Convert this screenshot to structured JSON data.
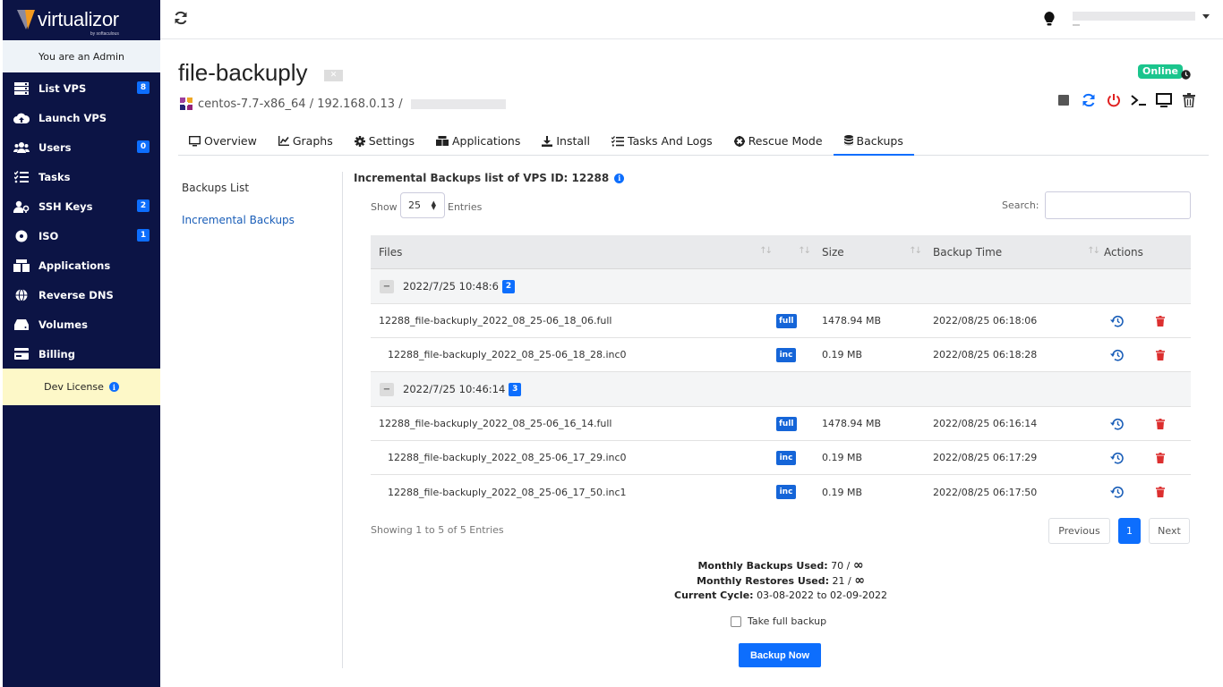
{
  "brand": {
    "name": "virtualizor",
    "sub": "by softaculous"
  },
  "sidebar": {
    "admin_text": "You are an Admin",
    "items": [
      {
        "label": "List VPS",
        "icon": "server-icon",
        "badge": "8"
      },
      {
        "label": "Launch VPS",
        "icon": "cloud-upload-icon",
        "badge": ""
      },
      {
        "label": "Users",
        "icon": "users-icon",
        "badge": "0"
      },
      {
        "label": "Tasks",
        "icon": "tasks-icon",
        "badge": ""
      },
      {
        "label": "SSH Keys",
        "icon": "user-key-icon",
        "badge": "2"
      },
      {
        "label": "ISO",
        "icon": "disc-icon",
        "badge": "1"
      },
      {
        "label": "Applications",
        "icon": "boxes-icon",
        "badge": ""
      },
      {
        "label": "Reverse DNS",
        "icon": "globe-icon",
        "badge": ""
      },
      {
        "label": "Volumes",
        "icon": "hdd-icon",
        "badge": ""
      },
      {
        "label": "Billing",
        "icon": "billing-icon",
        "badge": ""
      }
    ],
    "dev_license": "Dev License"
  },
  "vps": {
    "title": "file-backuply",
    "os": "centos-7.7-x86_64",
    "ip": "192.168.0.13",
    "separator": "/",
    "status": "Online"
  },
  "tabs": [
    {
      "label": "Overview",
      "icon": "monitor-icon"
    },
    {
      "label": "Graphs",
      "icon": "chart-icon"
    },
    {
      "label": "Settings",
      "icon": "gear-icon"
    },
    {
      "label": "Applications",
      "icon": "boxes-icon"
    },
    {
      "label": "Install",
      "icon": "download-icon"
    },
    {
      "label": "Tasks And Logs",
      "icon": "tasks-icon"
    },
    {
      "label": "Rescue Mode",
      "icon": "lifebuoy-icon"
    },
    {
      "label": "Backups",
      "icon": "database-icon"
    }
  ],
  "submenu": {
    "backups_list": "Backups List",
    "incremental": "Incremental Backups"
  },
  "main": {
    "title": "Incremental Backups list of VPS ID: 12288",
    "show_label": "Show",
    "show_value": "25",
    "entries_label": "Entries",
    "search_label": "Search:",
    "search_value": "",
    "headers": {
      "files": "Files",
      "size": "Size",
      "time": "Backup Time",
      "actions": "Actions"
    },
    "groups": [
      {
        "label": "2022/7/25 10:48:6",
        "count": "2",
        "rows": [
          {
            "file": "12288_file-backuply_2022_08_25-06_18_06.full",
            "type": "full",
            "size": "1478.94 MB",
            "time": "2022/08/25 06:18:06",
            "child": false
          },
          {
            "file": "12288_file-backuply_2022_08_25-06_18_28.inc0",
            "type": "inc",
            "size": "0.19 MB",
            "time": "2022/08/25 06:18:28",
            "child": true
          }
        ]
      },
      {
        "label": "2022/7/25 10:46:14",
        "count": "3",
        "rows": [
          {
            "file": "12288_file-backuply_2022_08_25-06_16_14.full",
            "type": "full",
            "size": "1478.94 MB",
            "time": "2022/08/25 06:16:14",
            "child": false
          },
          {
            "file": "12288_file-backuply_2022_08_25-06_17_29.inc0",
            "type": "inc",
            "size": "0.19 MB",
            "time": "2022/08/25 06:17:29",
            "child": true
          },
          {
            "file": "12288_file-backuply_2022_08_25-06_17_50.inc1",
            "type": "inc",
            "size": "0.19 MB",
            "time": "2022/08/25 06:17:50",
            "child": true
          }
        ]
      }
    ],
    "showing": "Showing 1 to 5 of 5 Entries",
    "pager": {
      "prev": "Previous",
      "page": "1",
      "next": "Next"
    },
    "usage": {
      "backups_label": "Monthly Backups Used:",
      "backups_value": "70 /",
      "infinity": "∞",
      "restores_label": "Monthly Restores Used:",
      "restores_value": "21 /",
      "cycle_label": "Current Cycle:",
      "cycle_value": "03-08-2022 to 02-09-2022"
    },
    "take_full": "Take full backup",
    "backup_now": "Backup Now"
  },
  "colors": {
    "sidebar": "#0c1445",
    "primary": "#0d6efd",
    "online": "#1bc58d",
    "danger": "#dc2f2f",
    "license": "#fdf8c8"
  }
}
